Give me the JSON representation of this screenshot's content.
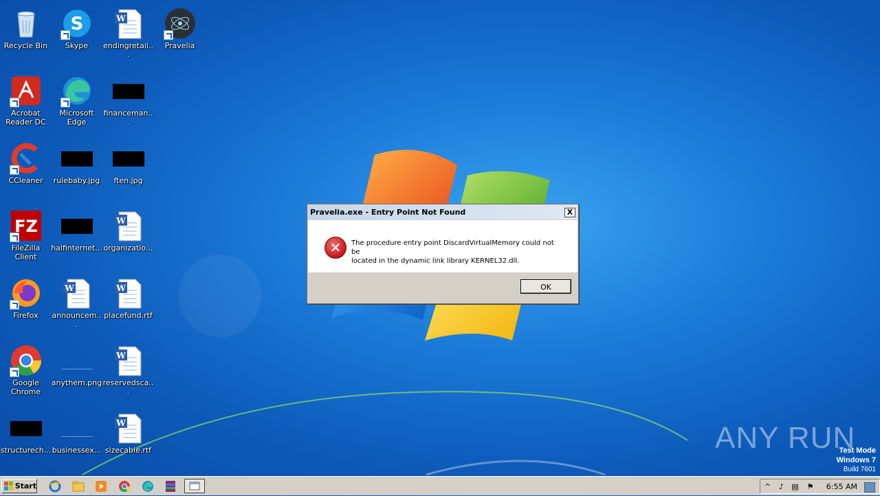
{
  "desktop": {
    "icons": [
      {
        "label": "Recycle Bin"
      },
      {
        "label": "Skype"
      },
      {
        "label": "endingretail..."
      },
      {
        "label": "Pravelia"
      },
      {
        "label": "Acrobat Reader DC"
      },
      {
        "label": "Microsoft Edge"
      },
      {
        "label": "financeman..."
      },
      {
        "label": "CCleaner"
      },
      {
        "label": "rulebaby.jpg"
      },
      {
        "label": "ften.jpg"
      },
      {
        "label": "FileZilla Client"
      },
      {
        "label": "halfinternet..."
      },
      {
        "label": "organizatio..."
      },
      {
        "label": "Firefox"
      },
      {
        "label": "announcem..."
      },
      {
        "label": "placefund.rtf"
      },
      {
        "label": "Google Chrome"
      },
      {
        "label": "anythem.png"
      },
      {
        "label": "reservedsca..."
      },
      {
        "label": "structurech..."
      },
      {
        "label": "businessex..."
      },
      {
        "label": "sizecable.rtf"
      }
    ]
  },
  "dialog": {
    "title": "Pravelia.exe - Entry Point Not Found",
    "close_label": "X",
    "message_line1": "The procedure entry point DiscardVirtualMemory could not be",
    "message_line2": "located in the dynamic link library KERNEL32.dll.",
    "ok_label": "OK"
  },
  "watermark": {
    "text": "ANY RUN",
    "mode_line1": "Test Mode",
    "mode_line2": "Windows 7",
    "mode_line3": "Build 7601"
  },
  "taskbar": {
    "start_label": "Start",
    "time": "6:55 AM"
  }
}
